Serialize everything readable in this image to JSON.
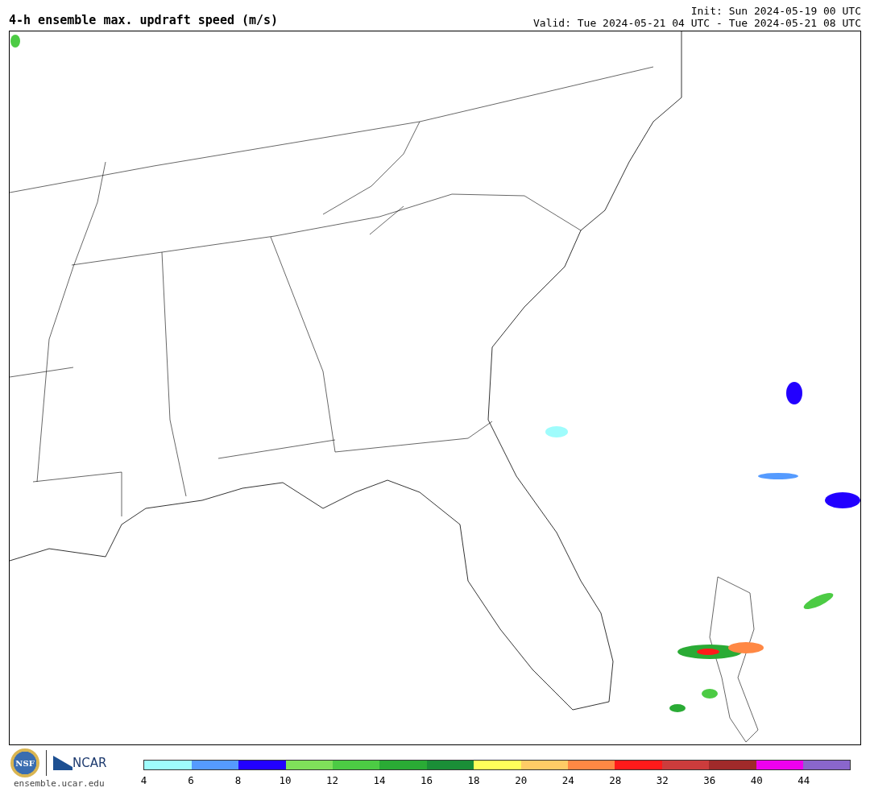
{
  "title": "4-h ensemble max. updraft speed (m/s)",
  "init": "Init: Sun 2024-05-19 00 UTC",
  "valid": "Valid: Tue 2024-05-21 04 UTC - Tue 2024-05-21 08 UTC",
  "logos": {
    "nsf": "NSF",
    "ncar": "NCAR",
    "website": "ensemble.ucar.edu"
  },
  "colorbar": {
    "segments": [
      {
        "color": "#9ffcfc"
      },
      {
        "color": "#559bff"
      },
      {
        "color": "#2200ff"
      },
      {
        "color": "#7fe05a"
      },
      {
        "color": "#4ccb44"
      },
      {
        "color": "#2aab35"
      },
      {
        "color": "#1a8e37"
      },
      {
        "color": "#ffff5a"
      },
      {
        "color": "#ffcc66"
      },
      {
        "color": "#ff8844"
      },
      {
        "color": "#ff1a1a"
      },
      {
        "color": "#cc3c3c"
      },
      {
        "color": "#a02a2a"
      },
      {
        "color": "#ee00ee"
      },
      {
        "color": "#8a66cc"
      }
    ],
    "ticks": [
      "4",
      "6",
      "8",
      "10",
      "12",
      "14",
      "16",
      "18",
      "20",
      "24",
      "28",
      "32",
      "36",
      "40",
      "44"
    ]
  }
}
